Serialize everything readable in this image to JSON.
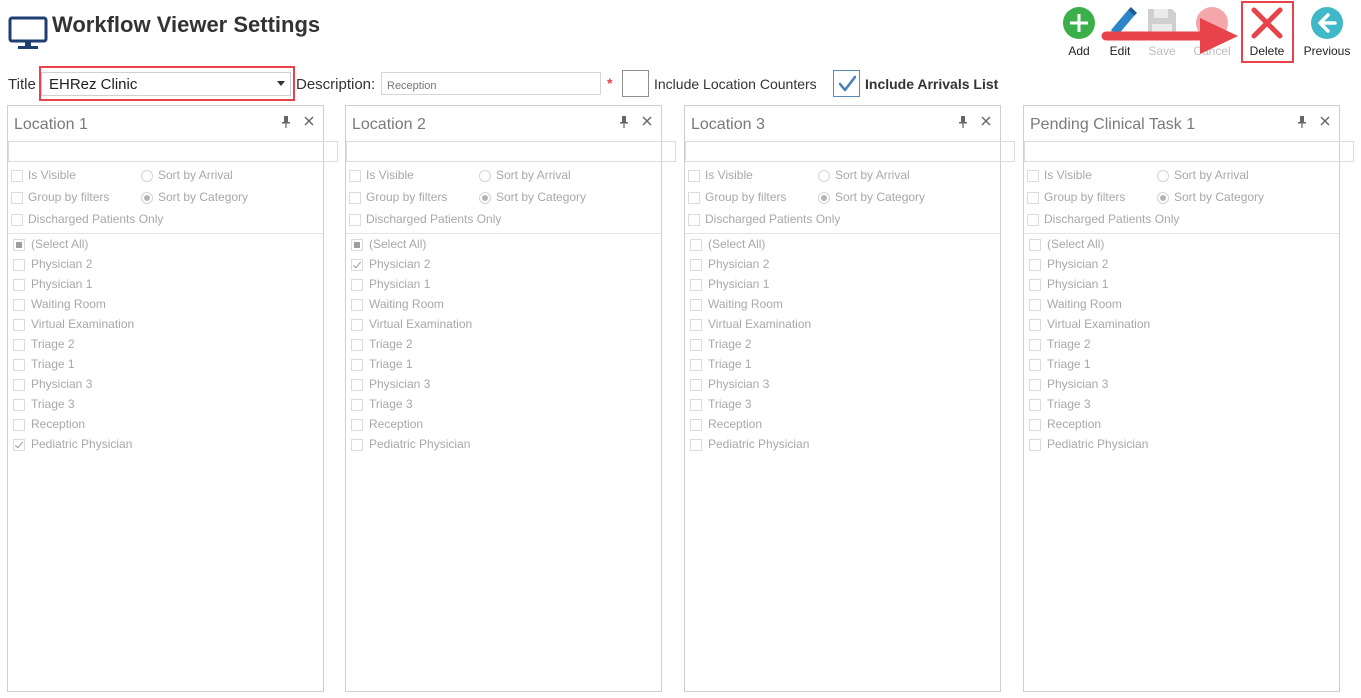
{
  "header": {
    "title": "Workflow Viewer Settings",
    "app_icon": "monitor-icon"
  },
  "toolbar": {
    "add": {
      "label": "Add",
      "icon": "plus-circle-icon",
      "color": "#3bb04a"
    },
    "edit": {
      "label": "Edit",
      "icon": "pencil-icon",
      "color": "#2a86c8"
    },
    "save": {
      "label": "Save",
      "icon": "floppy-disk-icon",
      "disabled": true
    },
    "cancel": {
      "label": "Cancel",
      "icon": "cancel-circle-icon",
      "disabled": true
    },
    "delete": {
      "label": "Delete",
      "icon": "x-icon",
      "color": "#e8424a"
    },
    "previous": {
      "label": "Previous",
      "icon": "arrow-left-circle-icon",
      "color": "#3fb8c7"
    }
  },
  "form": {
    "title_label": "Title",
    "title_value": "EHRez Clinic",
    "description_label": "Description:",
    "description_placeholder": "Reception",
    "required_mark": "*",
    "include_location_counters": {
      "label": "Include Location Counters",
      "checked": false
    },
    "include_arrivals_list": {
      "label": "Include Arrivals List",
      "checked": true
    }
  },
  "panel_labels": {
    "is_visible": "Is Visible",
    "sort_by_arrival": "Sort by Arrival",
    "group_by_filters": "Group by filters",
    "sort_by_category": "Sort by Category",
    "discharged_only": "Discharged Patients Only"
  },
  "panels": [
    {
      "title": "Location 1",
      "items": [
        {
          "label": "(Select All)",
          "state": "partial"
        },
        {
          "label": "Physician 2",
          "state": "unchecked"
        },
        {
          "label": "Physician 1",
          "state": "unchecked"
        },
        {
          "label": "Waiting Room",
          "state": "unchecked"
        },
        {
          "label": "Virtual Examination",
          "state": "unchecked"
        },
        {
          "label": "Triage 2",
          "state": "unchecked"
        },
        {
          "label": "Triage 1",
          "state": "unchecked"
        },
        {
          "label": "Physician 3",
          "state": "unchecked"
        },
        {
          "label": "Triage 3",
          "state": "unchecked"
        },
        {
          "label": "Reception",
          "state": "unchecked"
        },
        {
          "label": "Pediatric Physician",
          "state": "checked"
        }
      ]
    },
    {
      "title": "Location 2",
      "items": [
        {
          "label": "(Select All)",
          "state": "partial"
        },
        {
          "label": "Physician 2",
          "state": "checked"
        },
        {
          "label": "Physician 1",
          "state": "unchecked"
        },
        {
          "label": "Waiting Room",
          "state": "unchecked"
        },
        {
          "label": "Virtual Examination",
          "state": "unchecked"
        },
        {
          "label": "Triage 2",
          "state": "unchecked"
        },
        {
          "label": "Triage 1",
          "state": "unchecked"
        },
        {
          "label": "Physician 3",
          "state": "unchecked"
        },
        {
          "label": "Triage 3",
          "state": "unchecked"
        },
        {
          "label": "Reception",
          "state": "unchecked"
        },
        {
          "label": "Pediatric Physician",
          "state": "unchecked"
        }
      ]
    },
    {
      "title": "Location 3",
      "items": [
        {
          "label": "(Select All)",
          "state": "unchecked"
        },
        {
          "label": "Physician 2",
          "state": "unchecked"
        },
        {
          "label": "Physician 1",
          "state": "unchecked"
        },
        {
          "label": "Waiting Room",
          "state": "unchecked"
        },
        {
          "label": "Virtual Examination",
          "state": "unchecked"
        },
        {
          "label": "Triage 2",
          "state": "unchecked"
        },
        {
          "label": "Triage 1",
          "state": "unchecked"
        },
        {
          "label": "Physician 3",
          "state": "unchecked"
        },
        {
          "label": "Triage 3",
          "state": "unchecked"
        },
        {
          "label": "Reception",
          "state": "unchecked"
        },
        {
          "label": "Pediatric Physician",
          "state": "unchecked"
        }
      ]
    },
    {
      "title": "Pending Clinical Task 1",
      "items": [
        {
          "label": "(Select All)",
          "state": "unchecked"
        },
        {
          "label": "Physician 2",
          "state": "unchecked"
        },
        {
          "label": "Physician 1",
          "state": "unchecked"
        },
        {
          "label": "Waiting Room",
          "state": "unchecked"
        },
        {
          "label": "Virtual Examination",
          "state": "unchecked"
        },
        {
          "label": "Triage 2",
          "state": "unchecked"
        },
        {
          "label": "Triage 1",
          "state": "unchecked"
        },
        {
          "label": "Physician 3",
          "state": "unchecked"
        },
        {
          "label": "Triage 3",
          "state": "unchecked"
        },
        {
          "label": "Reception",
          "state": "unchecked"
        },
        {
          "label": "Pediatric Physician",
          "state": "unchecked"
        }
      ]
    }
  ]
}
